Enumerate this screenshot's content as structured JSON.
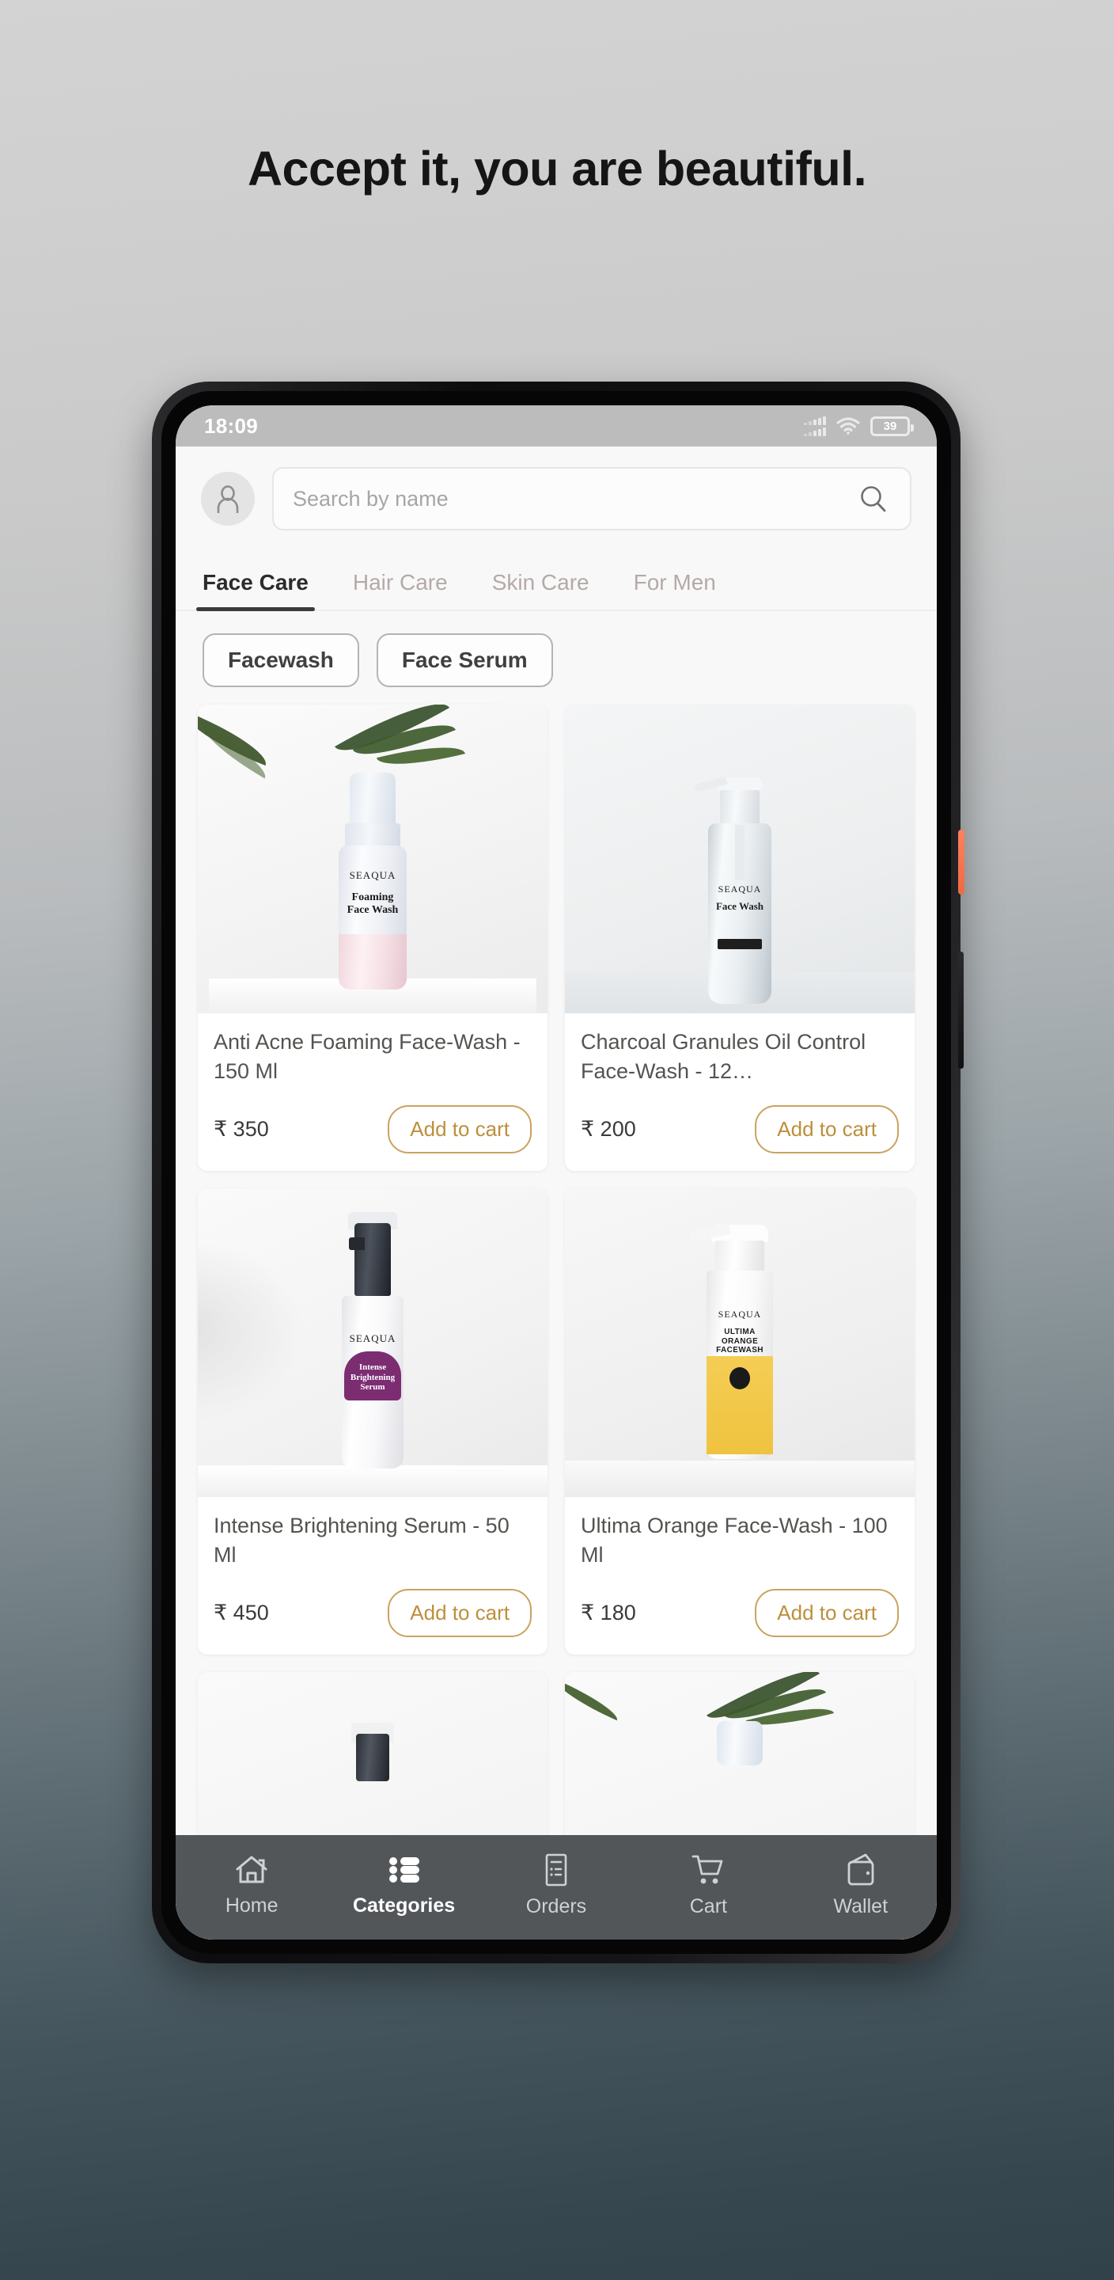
{
  "headline": "Accept it, you are beautiful.",
  "status_bar": {
    "time": "18:09",
    "battery_level": "39",
    "signal_icon": "signal-bars-icon",
    "wifi_icon": "wifi-icon",
    "battery_icon": "battery-icon"
  },
  "header": {
    "avatar_icon": "user-avatar-icon",
    "search_placeholder": "Search by name",
    "search_value": "",
    "search_icon": "search-icon"
  },
  "tabs": [
    {
      "label": "Face Care",
      "active": true
    },
    {
      "label": "Hair Care",
      "active": false
    },
    {
      "label": "Skin Care",
      "active": false
    },
    {
      "label": "For Men",
      "active": false
    }
  ],
  "chips": [
    {
      "label": "Facewash"
    },
    {
      "label": "Face Serum"
    }
  ],
  "products": [
    {
      "title": "Anti Acne Foaming Face-Wash - 150 Ml",
      "price": "₹ 350",
      "cta": "Add to cart",
      "brand": "SEAQUA",
      "label_text": "Foaming Face Wash",
      "label_color": "#f0d2d8",
      "cap_color": "#e6eaf2",
      "bottle_color": "#ecedf2"
    },
    {
      "title": "Charcoal Granules Oil Control Face-Wash - 12…",
      "price": "₹ 200",
      "cta": "Add to cart",
      "brand": "SEAQUA",
      "label_text": "Face Wash",
      "label_color": "#e8ecee",
      "cap_color": "#e2e6ea",
      "bottle_color": "#e4e9ec"
    },
    {
      "title": "Intense Brightening Serum - 50 Ml",
      "price": "₹ 450",
      "cta": "Add to cart",
      "brand": "SEAQUA",
      "label_text": "Intense Brightening Serum",
      "label_color": "#7c2d72",
      "cap_color": "#2b2f36",
      "bottle_color": "#fbfbfc"
    },
    {
      "title": "Ultima Orange Face-Wash - 100 Ml",
      "price": "₹ 180",
      "cta": "Add to cart",
      "brand": "SEAQUA",
      "label_text": "ULTIMA ORANGE FACEWASH",
      "label_color": "#f2c94c",
      "cap_color": "#fdfdfd",
      "bottle_color": "#fdfdfd"
    }
  ],
  "bottom_nav": [
    {
      "label": "Home",
      "icon": "home-icon",
      "active": false
    },
    {
      "label": "Categories",
      "icon": "list-icon",
      "active": true
    },
    {
      "label": "Orders",
      "icon": "orders-icon",
      "active": false
    },
    {
      "label": "Cart",
      "icon": "cart-icon",
      "active": false
    },
    {
      "label": "Wallet",
      "icon": "wallet-icon",
      "active": false
    }
  ],
  "colors": {
    "accent_gold": "#c9a35f",
    "nav_bg": "#535659",
    "app_bg": "#f8f8f8"
  }
}
